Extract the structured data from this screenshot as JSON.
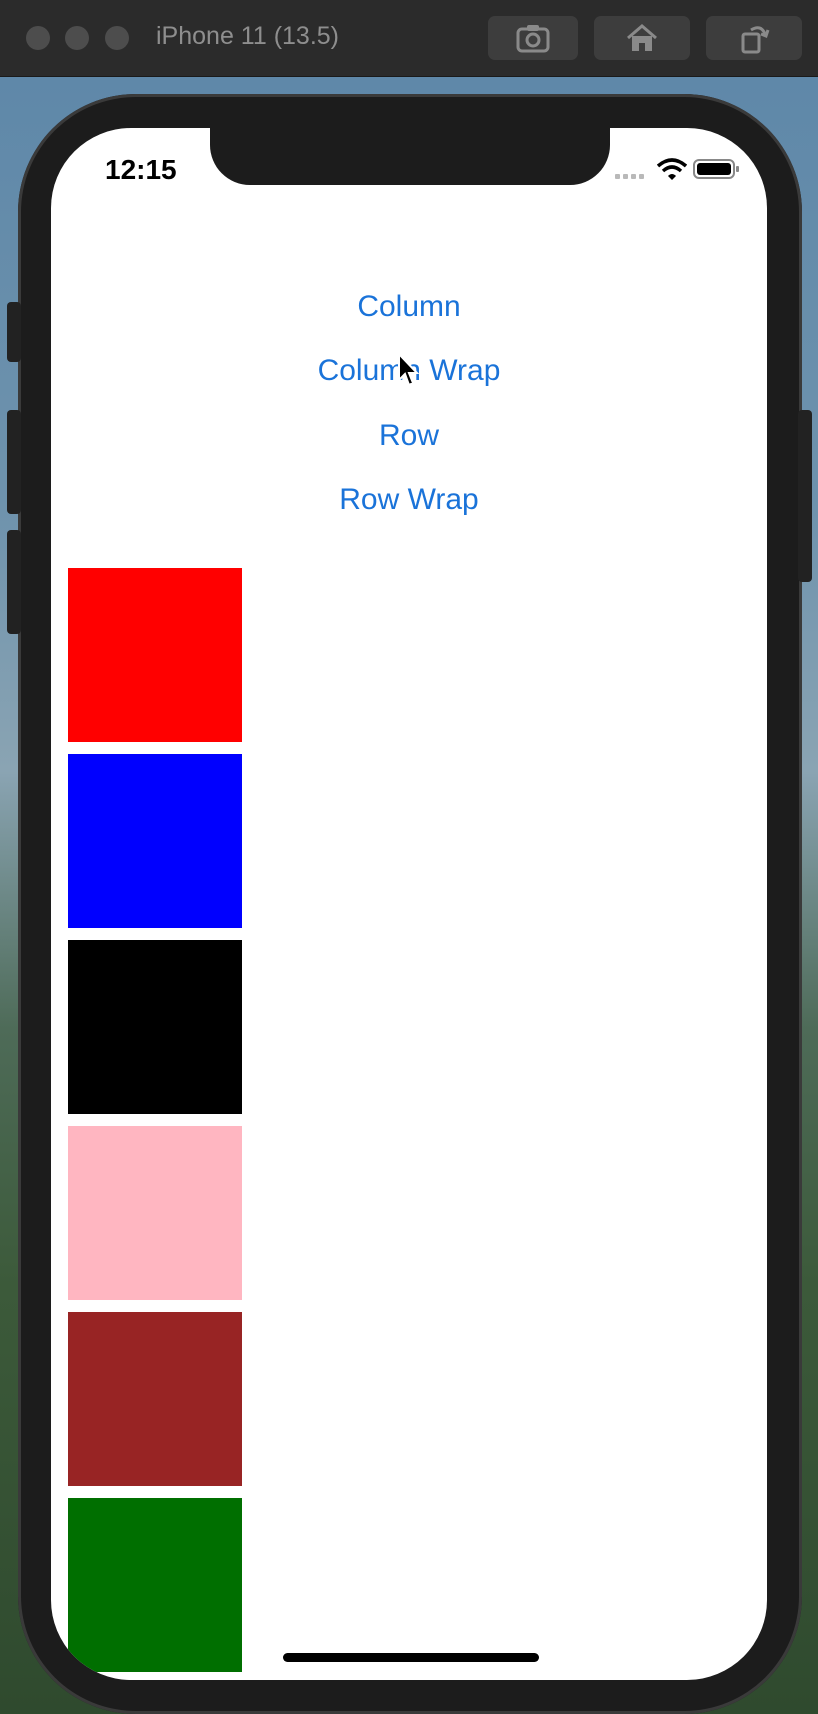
{
  "simulator": {
    "title": "iPhone 11 (13.5)",
    "buttons": [
      "screenshot-icon",
      "home-icon",
      "rotate-icon"
    ]
  },
  "status_bar": {
    "time": "12:15"
  },
  "menu": [
    {
      "label": "Column"
    },
    {
      "label": "Column Wrap"
    },
    {
      "label": "Row"
    },
    {
      "label": "Row Wrap"
    }
  ],
  "boxes": [
    {
      "color": "#ff0000"
    },
    {
      "color": "#0000ff"
    },
    {
      "color": "#000000"
    },
    {
      "color": "#ffb6c1"
    },
    {
      "color": "#982424"
    },
    {
      "color": "#006f00"
    }
  ],
  "colors": {
    "link": "#1a73d9"
  }
}
